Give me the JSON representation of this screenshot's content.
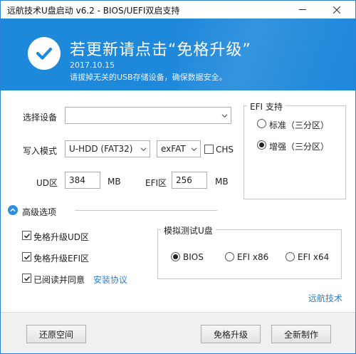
{
  "window": {
    "title": "远航技术U盘启动 v6.2 - BIOS/UEFI双启支持",
    "minimize_icon": "minimize-icon",
    "close_icon": "close-icon"
  },
  "banner": {
    "title": "若更新请点击“免格升级”",
    "date": "2017.10.15",
    "warning": "请拔掉无关的USB存储设备，确保数据安全。",
    "icon": "checkmark-icon",
    "color": "#1e88db"
  },
  "form": {
    "device_label": "选择设备",
    "device_value": "",
    "mode_label": "写入模式",
    "mode_value": "U-HDD (FAT32)",
    "fs_value": "exFAT",
    "chs_label": "CHS",
    "chs_checked": false,
    "ud_label": "UD区",
    "ud_value": "384",
    "ud_unit": "MB",
    "efi_label": "EFI区",
    "efi_value": "256",
    "efi_unit": "MB"
  },
  "efi_support": {
    "title": "EFI 支持",
    "options": [
      {
        "label": "标准（三分区）",
        "selected": false
      },
      {
        "label": "增强（三分区）",
        "selected": true
      }
    ]
  },
  "advanced": {
    "label": "高级选项",
    "toggle_icon": "chevron-up-icon",
    "options": [
      {
        "label": "免格升级UD区",
        "checked": true
      },
      {
        "label": "免格升级EFI区",
        "checked": true
      },
      {
        "label": "已阅读并同意",
        "checked": true
      }
    ],
    "agreement_link": "安装协议"
  },
  "simulate": {
    "title": "模拟测试U盘",
    "options": [
      {
        "label": "BIOS",
        "selected": true
      },
      {
        "label": "EFI x86",
        "selected": false
      },
      {
        "label": "EFI x64",
        "selected": false
      }
    ]
  },
  "brand_link": "远航技术",
  "buttons": {
    "restore": "还原空间",
    "upgrade": "免格升级",
    "create": "全新制作"
  },
  "colors": {
    "accent": "#2d8de3",
    "link": "#2d7fd3"
  }
}
